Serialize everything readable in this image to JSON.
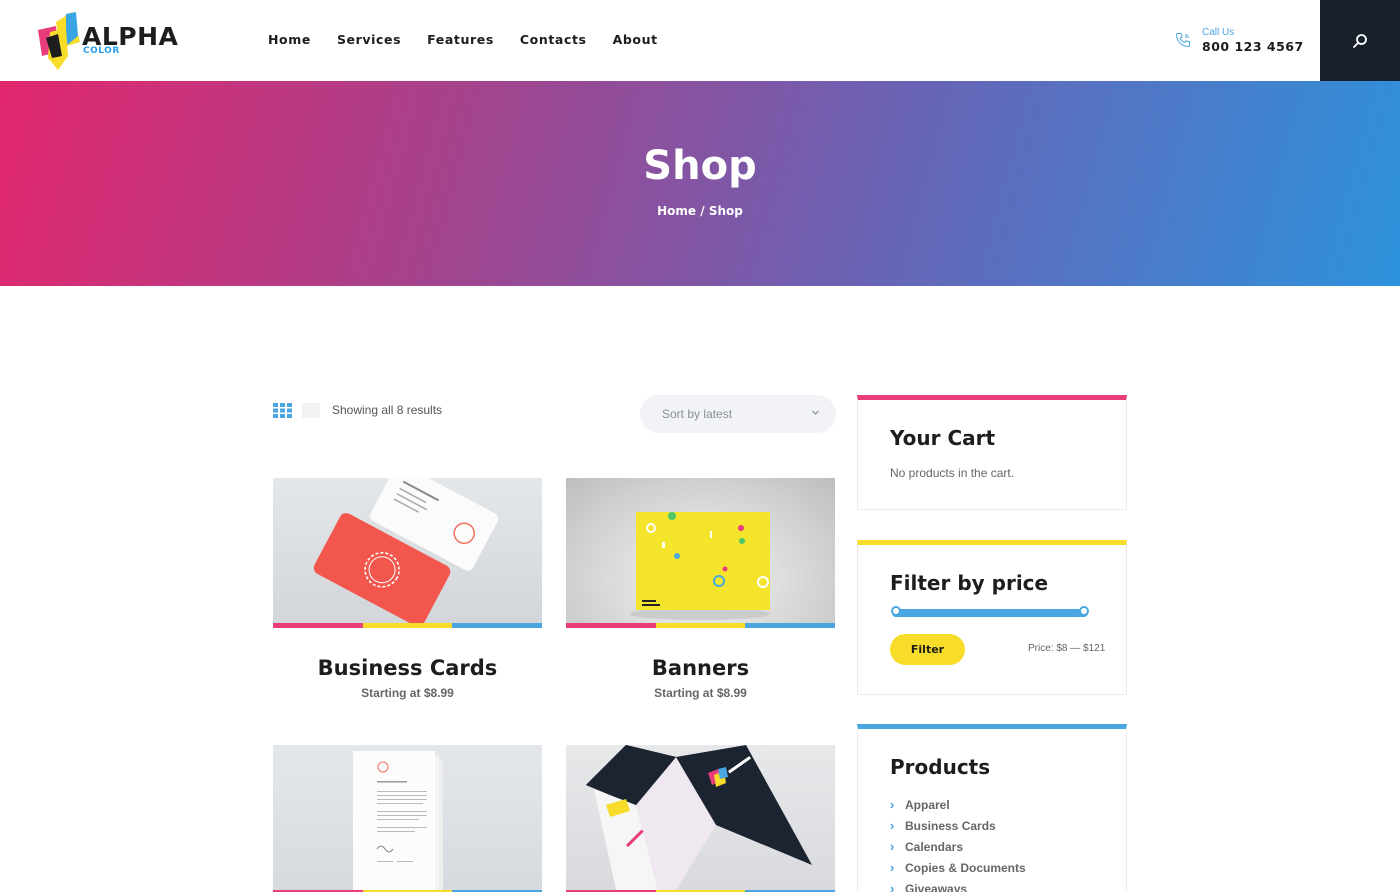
{
  "brand": {
    "name": "ALPHA",
    "sub": "COLOR"
  },
  "nav": [
    "Home",
    "Services",
    "Features",
    "Contacts",
    "About"
  ],
  "contact": {
    "label": "Call Us",
    "number": "800 123 4567"
  },
  "hero": {
    "title": "Shop",
    "breadcrumb_home": "Home",
    "breadcrumb_sep": " / ",
    "breadcrumb_current": "Shop"
  },
  "toolbar": {
    "result_count": "Showing all 8 results",
    "sort_value": "Sort by latest"
  },
  "products": [
    {
      "name": "Business Cards",
      "price": "Starting at $8.99"
    },
    {
      "name": "Banners",
      "price": "Starting at $8.99"
    },
    {
      "name": "",
      "price": ""
    },
    {
      "name": "",
      "price": ""
    }
  ],
  "sidebar": {
    "cart": {
      "title": "Your Cart",
      "empty": "No products in the cart."
    },
    "filter": {
      "title": "Filter by price",
      "button": "Filter",
      "range": "Price: $8 — $121",
      "min_fraction": 0.0,
      "max_fraction": 1.0
    },
    "products": {
      "title": "Products",
      "items": [
        "Apparel",
        "Business Cards",
        "Calendars",
        "Copies & Documents",
        "Giveaways"
      ]
    }
  },
  "colors": {
    "pink": "#e93d7b",
    "yellow": "#f7dc29",
    "blue": "#4aa6e0",
    "dark": "#18202b"
  },
  "icons": {
    "phone": "phone-icon",
    "search": "search-icon",
    "grid": "grid-view-icon",
    "list": "list-view-icon",
    "chevron": "chevron-down-icon",
    "arrow": "chevron-right-icon"
  }
}
